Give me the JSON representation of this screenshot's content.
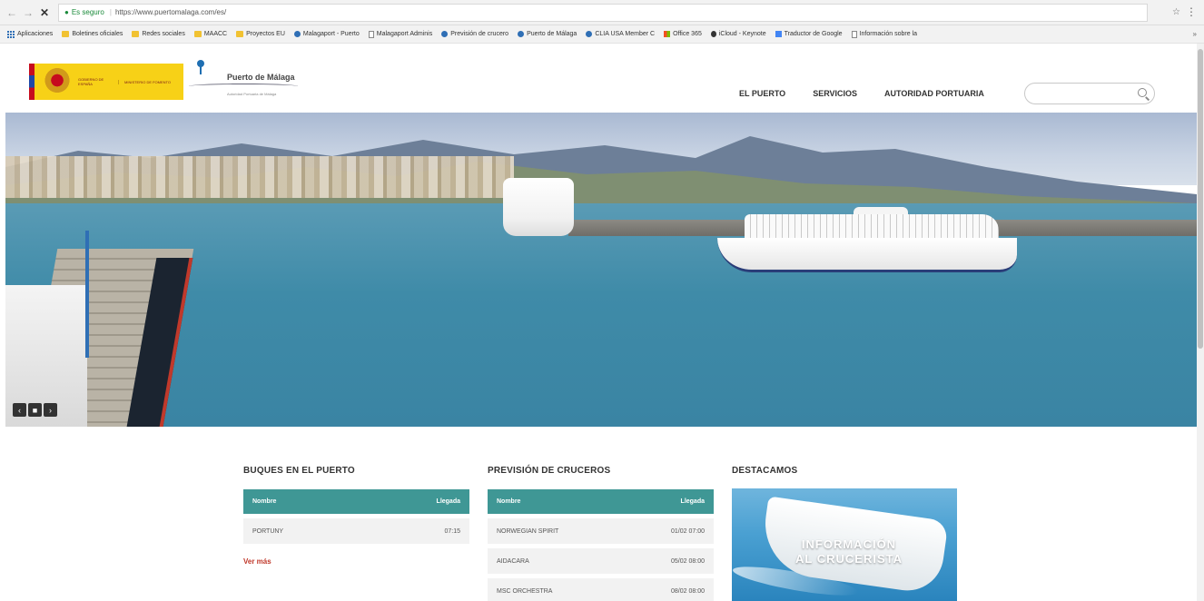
{
  "browser": {
    "secure_label": "Es seguro",
    "url": "https://www.puertomalaga.com/es/",
    "bookmarks": [
      {
        "label": "Aplicaciones",
        "icon": "apps-icon"
      },
      {
        "label": "Boletines oficiales",
        "icon": "folder-icon"
      },
      {
        "label": "Redes sociales",
        "icon": "folder-icon"
      },
      {
        "label": "MAACC",
        "icon": "folder-icon"
      },
      {
        "label": "Proyectos EU",
        "icon": "folder-icon"
      },
      {
        "label": "Malagaport - Puerto",
        "icon": "site-icon"
      },
      {
        "label": "Malagaport Adminis",
        "icon": "page-icon"
      },
      {
        "label": "Previsión de crucero",
        "icon": "site-icon"
      },
      {
        "label": "Puerto de Málaga",
        "icon": "site-icon"
      },
      {
        "label": "CLIA USA Member C",
        "icon": "site-icon"
      },
      {
        "label": "Office 365",
        "icon": "ms-icon"
      },
      {
        "label": "iCloud - Keynote",
        "icon": "apple-icon"
      },
      {
        "label": "Traductor de Google",
        "icon": "translate-icon"
      },
      {
        "label": "Información sobre la",
        "icon": "page-icon"
      }
    ],
    "more_label": "»"
  },
  "header": {
    "gov_line1": "GOBIERNO DE ESPAÑA",
    "gov_line2": "MINISTERIO DE FOMENTO",
    "port_name": "Puerto de Málaga",
    "port_sub": "Autoridad Portuaria de Málaga",
    "nav": [
      "EL PUERTO",
      "SERVICIOS",
      "AUTORIDAD PORTUARIA"
    ],
    "search_placeholder": ""
  },
  "carousel": {
    "prev": "‹",
    "pause": "■",
    "next": "›"
  },
  "buques": {
    "title": "BUQUES EN EL PUERTO",
    "col_name": "Nombre",
    "col_time": "Llegada",
    "rows": [
      {
        "name": "PORTUNY",
        "time": "07:15"
      }
    ],
    "more": "Ver más"
  },
  "cruceros": {
    "title": "PREVISIÓN DE CRUCEROS",
    "col_name": "Nombre",
    "col_time": "Llegada",
    "rows": [
      {
        "name": "NORWEGIAN SPIRIT",
        "time": "01/02 07:00"
      },
      {
        "name": "AIDACARA",
        "time": "05/02 08:00"
      },
      {
        "name": "MSC ORCHESTRA",
        "time": "08/02 08:00"
      }
    ]
  },
  "destacamos": {
    "title": "DESTACAMOS",
    "banner_line1": "INFORMACIÓN",
    "banner_line2": "AL CRUCERISTA"
  },
  "colors": {
    "table_header": "#3f9795",
    "link_red": "#c0392b",
    "gov_yellow": "#f7d117"
  }
}
